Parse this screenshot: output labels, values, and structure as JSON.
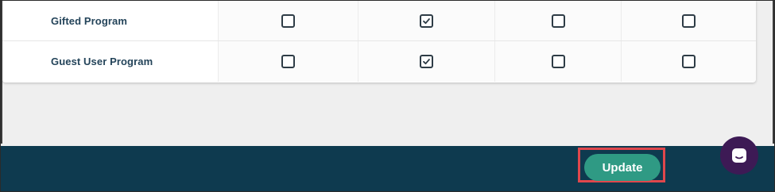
{
  "permissions_table": {
    "rows": [
      {
        "label": "Gifted Program",
        "checkboxes": [
          false,
          true,
          false,
          false
        ]
      },
      {
        "label": "Guest User Program",
        "checkboxes": [
          false,
          true,
          false,
          false
        ]
      }
    ]
  },
  "footer": {
    "update_label": "Update",
    "background_color": "#0e3a4f",
    "button_color": "#2f9a84",
    "highlight_color": "#e0474c"
  },
  "chat_widget": {
    "icon": "chat-bubble-icon",
    "color": "#3d1a55"
  }
}
